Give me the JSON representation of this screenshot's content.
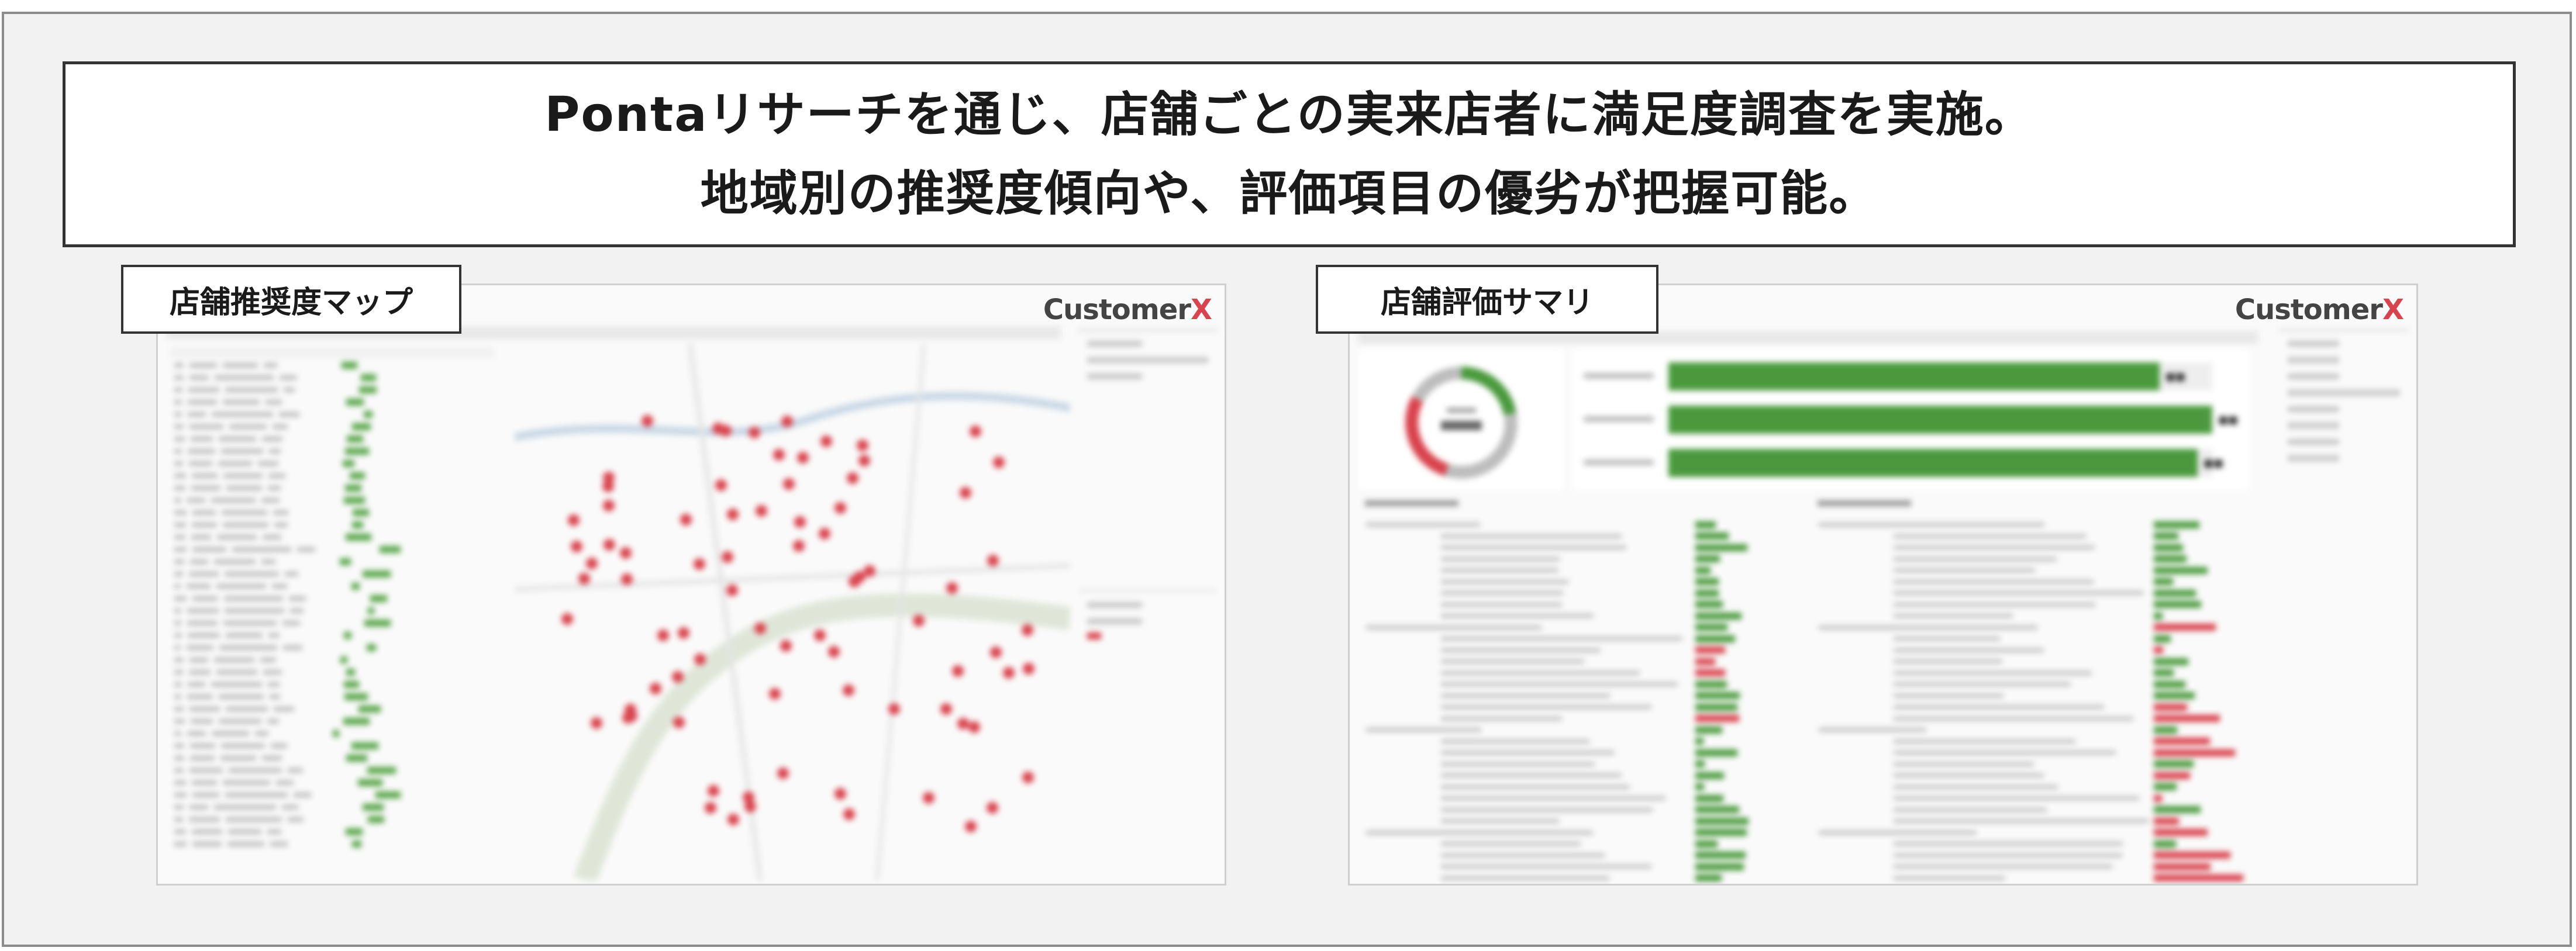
{
  "headline": {
    "line1": "Pontaリサーチを通じ、店舗ごとの実来店者に満足度調査を実施。",
    "line2": "地域別の推奨度傾向や、評価項目の優劣が把握可能。"
  },
  "panels": {
    "left": {
      "tag": "店舗推奨度マップ"
    },
    "right": {
      "tag": "店舗評価サマリ"
    }
  },
  "brand": {
    "name": "Customer",
    "mark": "X"
  },
  "colors": {
    "accent_red": "#d9434d",
    "bar_green": "#4a9a3d",
    "frame_gray": "#8c8c8c"
  }
}
